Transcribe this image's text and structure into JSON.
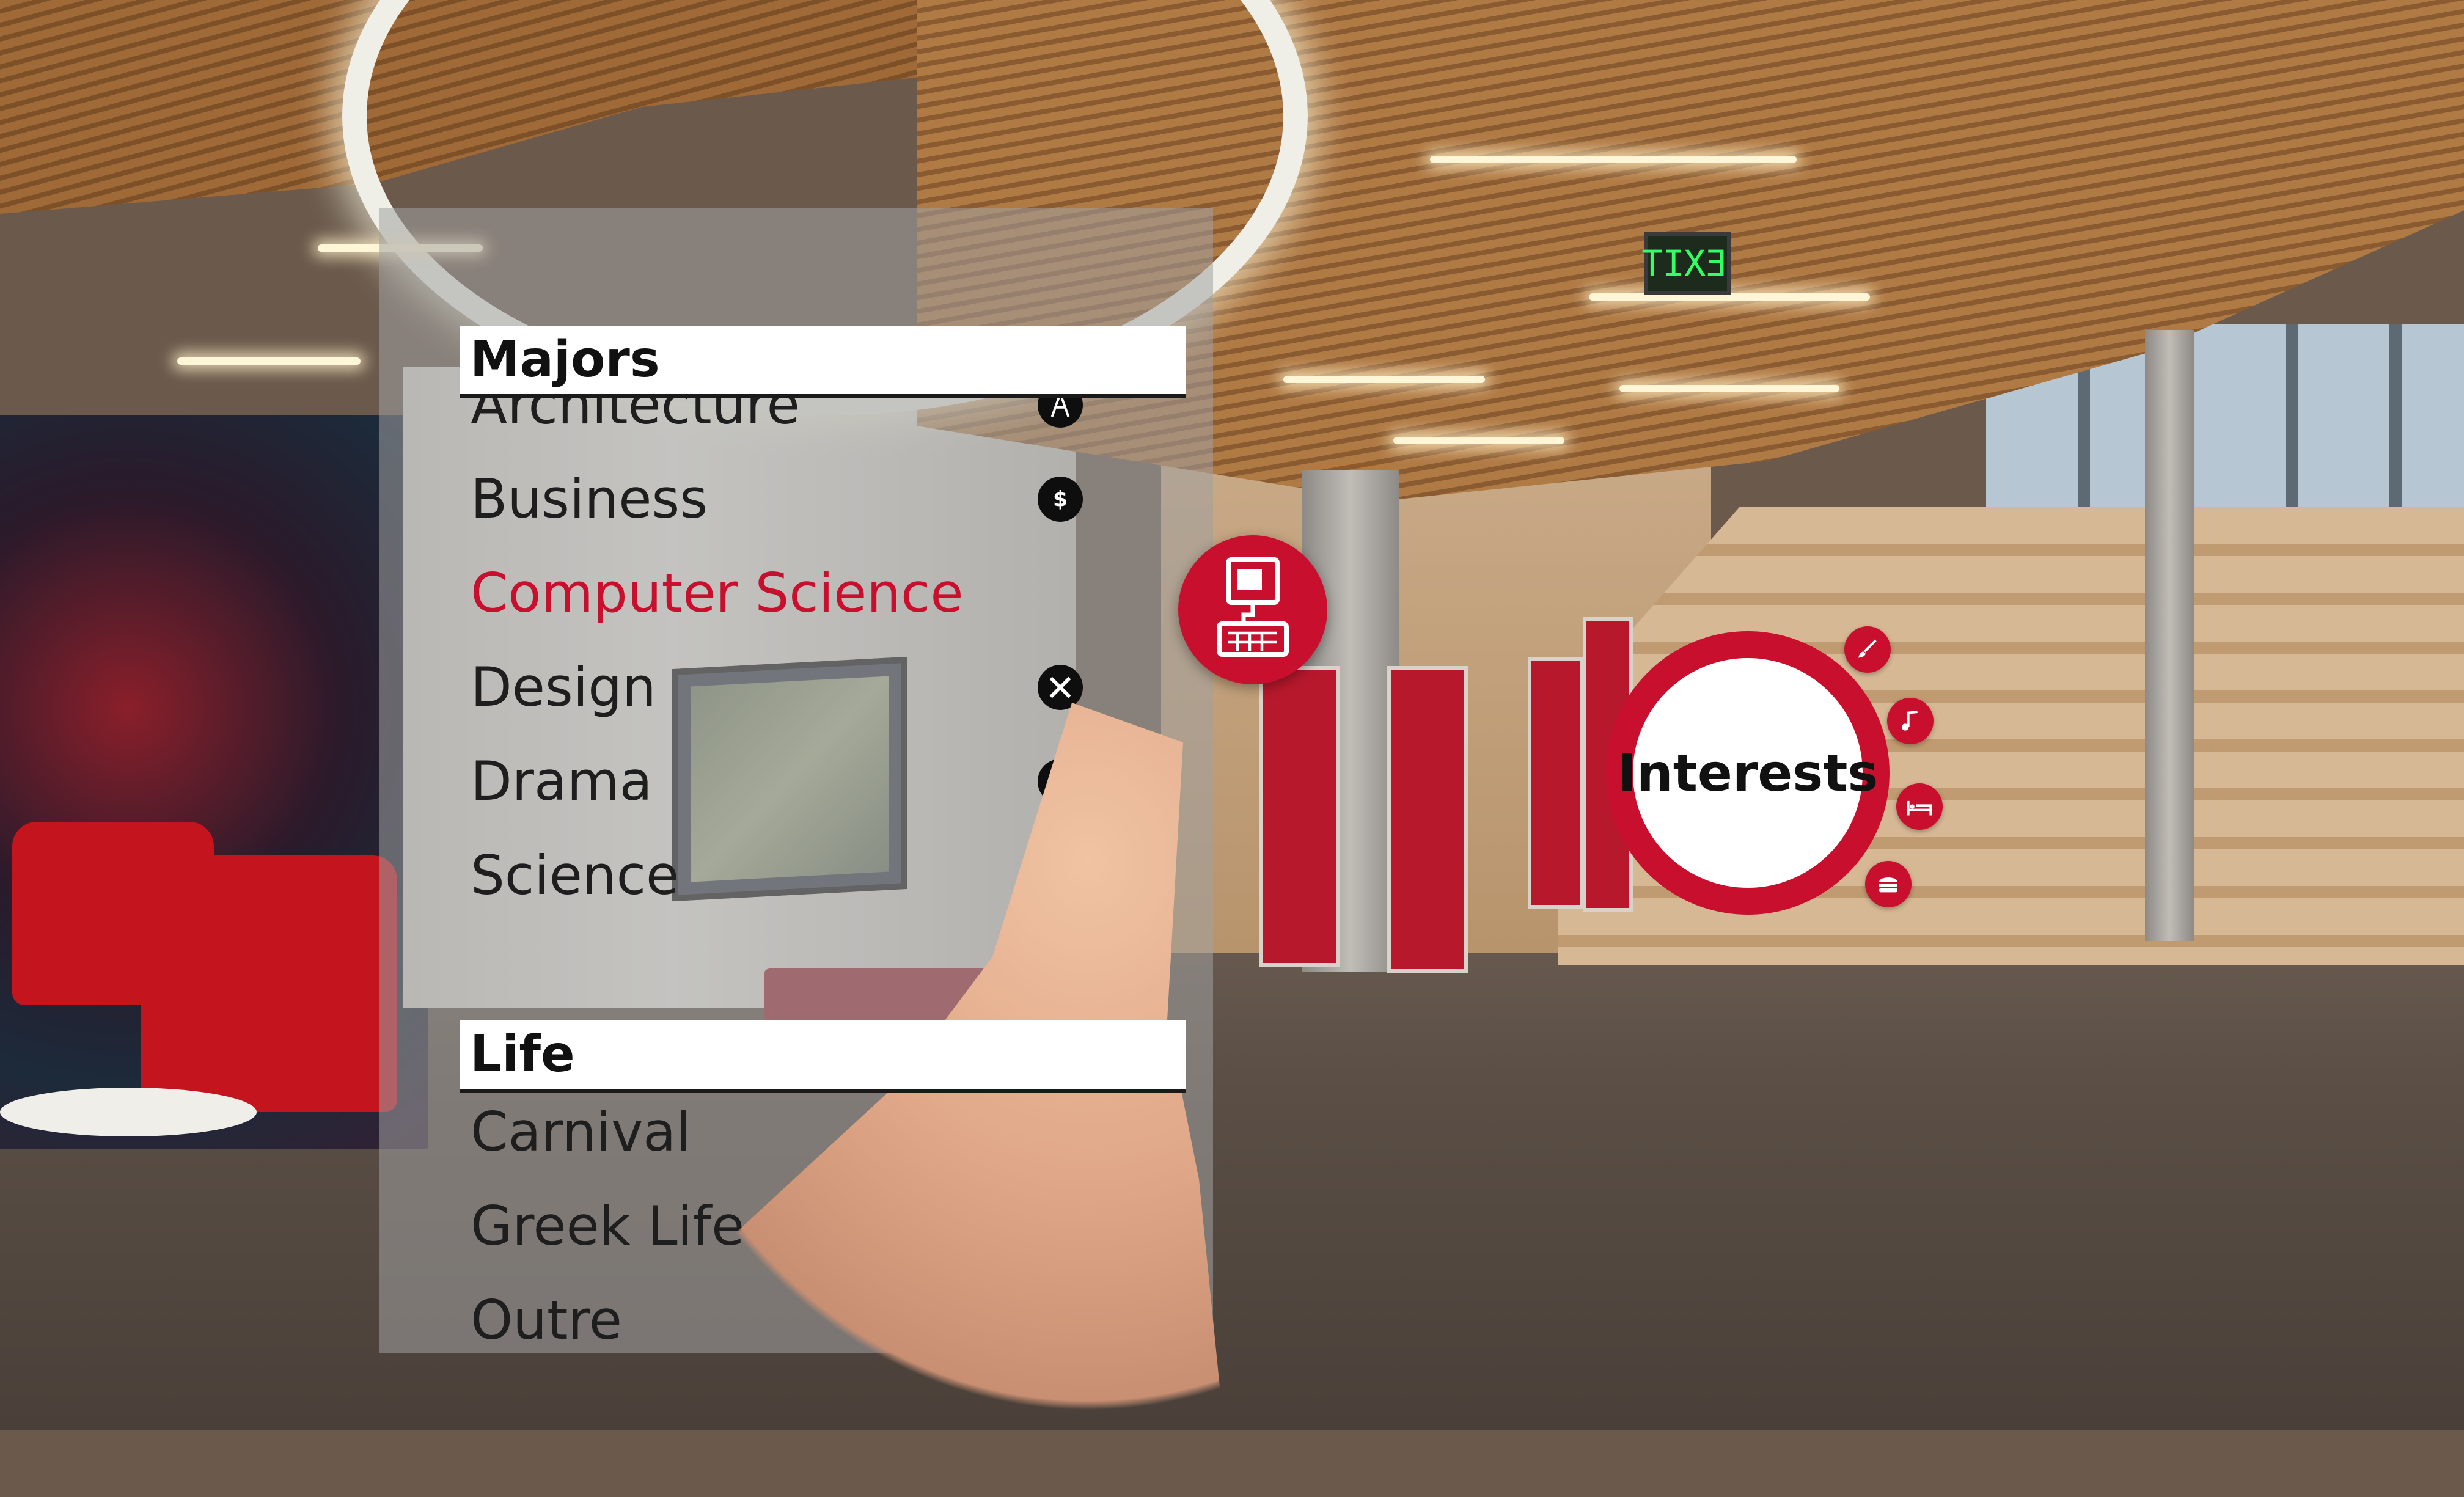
{
  "majors": {
    "header": "Majors",
    "items": [
      {
        "label": "Architecture",
        "icon": "compass-icon",
        "selected": false
      },
      {
        "label": "Business",
        "icon": "dollar-icon",
        "selected": false
      },
      {
        "label": "Computer Science",
        "icon": "computer-icon",
        "selected": true
      },
      {
        "label": "Design",
        "icon": "pencil-ruler-icon",
        "selected": false
      },
      {
        "label": "Drama",
        "icon": "theater-masks-icon",
        "selected": false
      },
      {
        "label": "Science",
        "icon": "flask-icon",
        "selected": false
      }
    ]
  },
  "life": {
    "header": "Life",
    "items": [
      {
        "label": "Carnival"
      },
      {
        "label": "Greek Life"
      },
      {
        "label": "Outre"
      }
    ]
  },
  "interests": {
    "label": "Interests",
    "options": [
      {
        "icon": "paintbrush-icon"
      },
      {
        "icon": "music-note-icon"
      },
      {
        "icon": "bed-icon"
      },
      {
        "icon": "burger-icon"
      }
    ]
  },
  "environment": {
    "exit_sign": "EXIT"
  },
  "colors": {
    "accent": "#c8102e",
    "panel": "rgba(160,160,160,0.55)",
    "header_bg": "#ffffff",
    "icon_bg": "#0e0e0e"
  }
}
